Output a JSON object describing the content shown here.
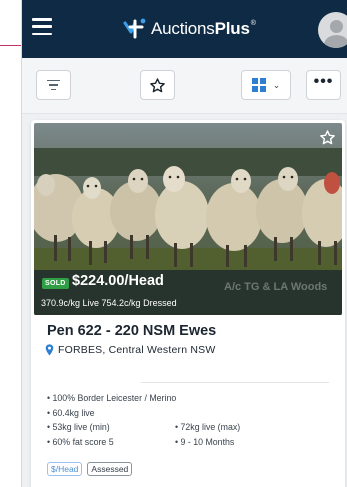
{
  "app": {
    "brand_regular": "Auctions",
    "brand_bold": "Plus",
    "brand_mark": "®"
  },
  "navbar": {
    "menu_icon": "hamburger-icon",
    "avatar_icon": "user-avatar-icon",
    "background_color": "#0e2a44"
  },
  "toolbar": {
    "filter_icon": "filter-icon",
    "watchlist_icon": "star-outline-icon",
    "view_icon": "grid-view-icon",
    "view_chevron": "⌄",
    "more_label": "•••"
  },
  "listing": {
    "status_badge": "SOLD",
    "price": "$224.00/Head",
    "price_detail": "370.9c/kg Live 754.2c/kg Dressed",
    "vendor": "A/c TG & LA Woods",
    "title": "Pen 622 - 220 NSM Ewes",
    "location": "FORBES, Central Western NSW",
    "favourite_icon": "star-outline-icon",
    "details": [
      [
        "• 100% Border Leicester / Merino",
        ""
      ],
      [
        "• 60.4kg live",
        ""
      ],
      [
        "• 53kg live (min)",
        "• 72kg live (max)"
      ],
      [
        "• 60% fat score 5",
        "• 9 - 10 Months"
      ]
    ],
    "tags": [
      "$/Head",
      "Assessed"
    ],
    "sold_color": "#2f9e44"
  }
}
